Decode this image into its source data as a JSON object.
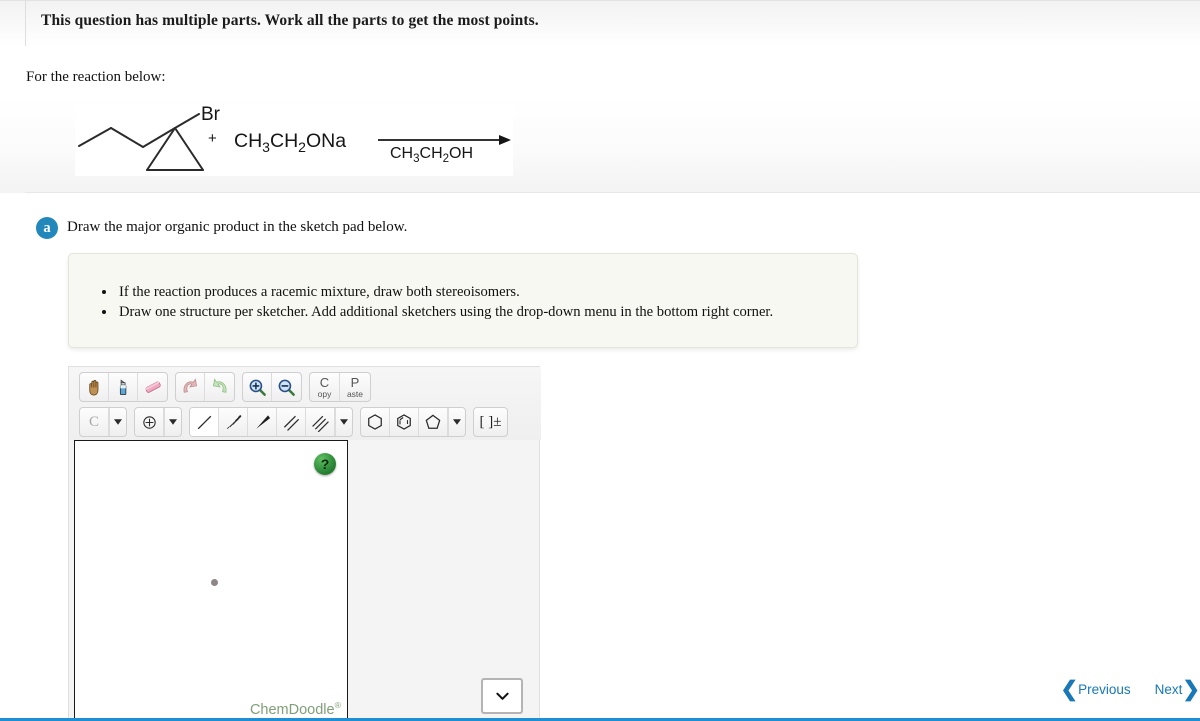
{
  "header": {
    "title": "This question has multiple parts. Work all the parts to get the most points."
  },
  "question": {
    "prompt": "For the reaction below:",
    "reaction": {
      "substrate_label": "Br",
      "plus": "+",
      "reagent": "CH3CH2ONa",
      "reagent_parts": {
        "a": "CH",
        "a_sub": "3",
        "b": "CH",
        "b_sub": "2",
        "c": "ONa"
      },
      "solvent": "CH3CH2OH",
      "solvent_parts": {
        "a": "CH",
        "a_sub": "3",
        "b": "CH",
        "b_sub": "2",
        "c": "OH"
      }
    }
  },
  "part_a": {
    "badge": "a",
    "text": "Draw the major organic product in the sketch pad below.",
    "instructions": [
      "If the reaction produces a racemic mixture, draw both stereoisomers.",
      "Draw one structure per sketcher. Add additional sketchers using the drop-down menu in the bottom right corner."
    ]
  },
  "sketcher": {
    "toolbar_row1": [
      {
        "name": "hand-tool",
        "icon": "hand-icon"
      },
      {
        "name": "clear-tool",
        "icon": "spray-bottle-icon"
      },
      {
        "name": "eraser-tool",
        "icon": "eraser-icon"
      },
      {
        "name": "undo-tool",
        "icon": "undo-arrow-icon"
      },
      {
        "name": "redo-tool",
        "icon": "redo-arrow-icon"
      },
      {
        "name": "zoom-in-tool",
        "icon": "magnifier-plus-icon"
      },
      {
        "name": "zoom-out-tool",
        "icon": "magnifier-minus-icon"
      }
    ],
    "copy_label_big": "C",
    "copy_label_small": "opy",
    "paste_label_big": "P",
    "paste_label_small": "aste",
    "atom_label": "C",
    "charge_tool_label": "[ ]±",
    "caret": "▼",
    "help_label": "?",
    "branding": "ChemDoodle",
    "branding_mark": "®",
    "select_caret": "⌄",
    "select_value": ""
  },
  "navigation": {
    "previous": "Previous",
    "next": "Next",
    "prev_chevron": "❮",
    "next_chevron": "❯"
  },
  "colors": {
    "accent_blue": "#1f8fd4",
    "badge_blue": "#2288bb",
    "link_blue": "#1878b8",
    "chemdoodle_green": "#7f9f78",
    "instruction_bg": "#f8f8f2"
  }
}
